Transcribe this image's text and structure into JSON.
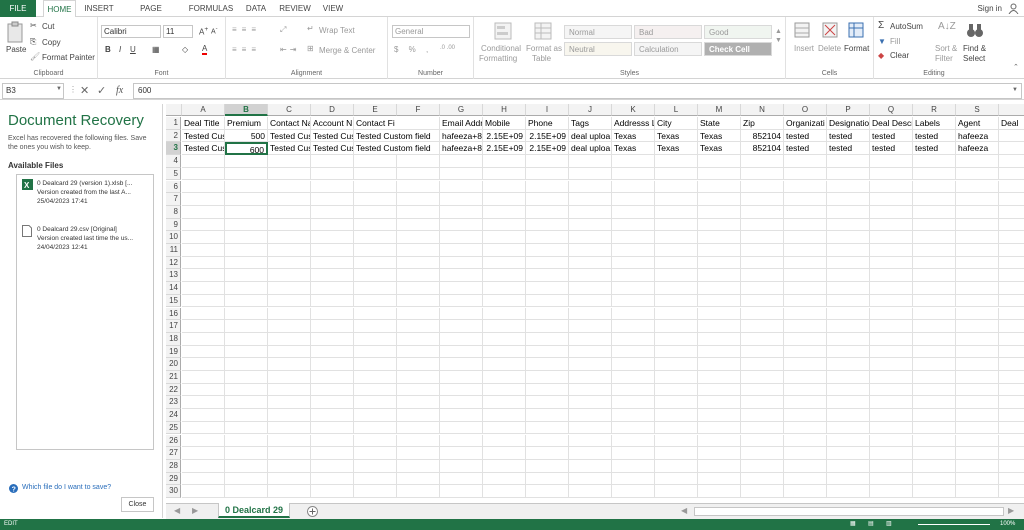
{
  "menu": {
    "file": "FILE",
    "tabs": [
      "HOME",
      "INSERT",
      "PAGE LAYOUT",
      "FORMULAS",
      "DATA",
      "REVIEW",
      "VIEW"
    ],
    "sign_in": "Sign in"
  },
  "ribbon": {
    "clipboard": {
      "paste": "Paste",
      "cut": "Cut",
      "copy": "Copy",
      "format_painter": "Format Painter",
      "label": "Clipboard"
    },
    "font": {
      "name": "Calibri",
      "size": "11",
      "label": "Font"
    },
    "alignment": {
      "wrap_text": "Wrap Text",
      "merge_center": "Merge & Center",
      "label": "Alignment"
    },
    "number": {
      "format": "General",
      "label": "Number"
    },
    "styles": {
      "conditional": "Conditional",
      "conditional2": "Formatting",
      "format_as": "Format as",
      "table": "Table",
      "normal": "Normal",
      "bad": "Bad",
      "good": "Good",
      "neutral": "Neutral",
      "calculation": "Calculation",
      "check_cell": "Check Cell",
      "label": "Styles"
    },
    "cells": {
      "insert": "Insert",
      "delete": "Delete",
      "format": "Format",
      "label": "Cells"
    },
    "editing": {
      "autosum": "AutoSum",
      "fill": "Fill",
      "clear": "Clear",
      "sort": "Sort &",
      "filter": "Filter",
      "find": "Find &",
      "select": "Select",
      "label": "Editing"
    }
  },
  "formula_bar": {
    "name_box": "B3",
    "formula": "600",
    "fx": "fx"
  },
  "recovery": {
    "title": "Document Recovery",
    "description": "Excel has recovered the following files.  Save the ones you wish to keep.",
    "available": "Available Files",
    "files": [
      {
        "name": "0 Dealcard 29 (version 1).xlsb  [...",
        "note": "Version created from the last A...",
        "date": "25/04/2023 17:41"
      },
      {
        "name": "0 Dealcard 29.csv  [Original]",
        "note": "Version created last time the us...",
        "date": "24/04/2023 12:41"
      }
    ],
    "help": "Which file do I want to save?",
    "close": "Close"
  },
  "grid": {
    "columns": [
      "A",
      "B",
      "C",
      "D",
      "E",
      "F",
      "G",
      "H",
      "I",
      "J",
      "K",
      "L",
      "M",
      "N",
      "O",
      "P",
      "Q",
      "R",
      "S",
      ""
    ],
    "rows": [
      [
        "Deal Title",
        "Premium",
        "Contact Na",
        "Account N",
        "Contact Fi",
        "Contact La",
        "Email Addr",
        "Mobile",
        "Phone",
        "Tags",
        "Addresss L",
        "City",
        "State",
        "Zip",
        "Organizati",
        "Designatio",
        "Deal Descr",
        "Labels",
        "Agent",
        "Deal"
      ],
      [
        "Tested Cus",
        "500",
        "Tested Cus",
        "Tested Cus",
        "Tested Custom field",
        "",
        "hafeeza+8",
        "2.15E+09",
        "2.15E+09",
        "deal uploa",
        "Texas",
        "Texas",
        "Texas",
        "852104",
        "tested",
        "tested",
        "tested",
        "tested",
        "hafeeza",
        "###"
      ],
      [
        "Tested Cus",
        "600",
        "Tested Cus",
        "Tested Cus",
        "Tested Custom field",
        "",
        "hafeeza+8",
        "2.15E+09",
        "2.15E+09",
        "deal uploa",
        "Texas",
        "Texas",
        "Texas",
        "852104",
        "tested",
        "tested",
        "tested",
        "tested",
        "hafeeza",
        "###"
      ]
    ],
    "row_count": 30
  },
  "sheet": {
    "tab": "0 Dealcard 29"
  },
  "status": {
    "mode": "EDIT",
    "zoom": "100%"
  }
}
